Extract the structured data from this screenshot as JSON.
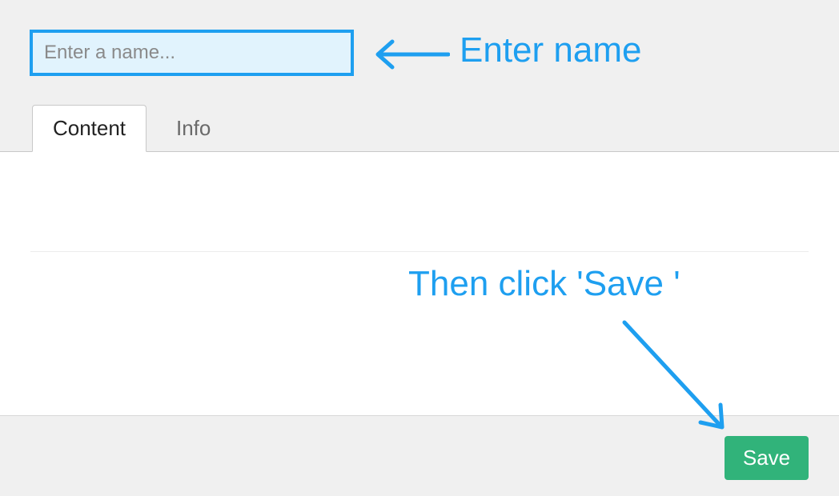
{
  "name_input": {
    "placeholder": "Enter a name...",
    "value": ""
  },
  "tabs": {
    "content_label": "Content",
    "info_label": "Info"
  },
  "annotations": {
    "enter_name": "Enter name",
    "then_click_save": "Then click 'Save '"
  },
  "buttons": {
    "save_label": "Save"
  },
  "colors": {
    "accent": "#1e9ff0",
    "save_bg": "#31b37a"
  }
}
